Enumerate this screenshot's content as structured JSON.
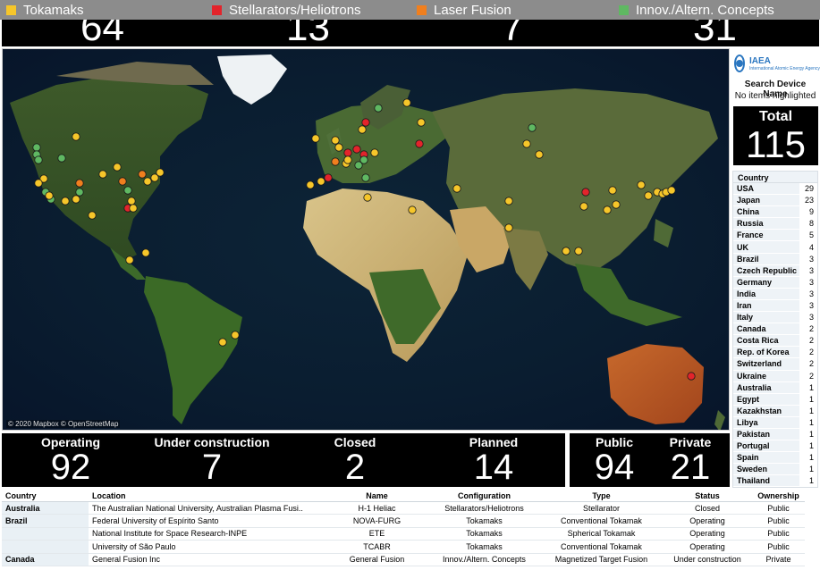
{
  "legend": [
    {
      "label": "Tokamaks",
      "color": "#f6c62a"
    },
    {
      "label": "Stellarators/Heliotrons",
      "color": "#e3242b"
    },
    {
      "label": "Laser Fusion",
      "color": "#f07f1e"
    },
    {
      "label": "Innov./Altern. Concepts",
      "color": "#5fb862"
    }
  ],
  "top_counts": [
    "64",
    "13",
    "7",
    "31"
  ],
  "map": {
    "attribution": "© 2020 Mapbox © OpenStreetMap"
  },
  "logo": {
    "title": "IAEA",
    "subtitle": "International Atomic Energy Agency"
  },
  "search": {
    "label": "Search Device Name",
    "status": "No items highlighted"
  },
  "total": {
    "label": "Total",
    "value": "115"
  },
  "country_list": {
    "header": "Country",
    "rows": [
      {
        "country": "USA",
        "count": "29"
      },
      {
        "country": "Japan",
        "count": "23"
      },
      {
        "country": "China",
        "count": "9"
      },
      {
        "country": "Russia",
        "count": "8"
      },
      {
        "country": "France",
        "count": "5"
      },
      {
        "country": "UK",
        "count": "4"
      },
      {
        "country": "Brazil",
        "count": "3"
      },
      {
        "country": "Czech Republic",
        "count": "3"
      },
      {
        "country": "Germany",
        "count": "3"
      },
      {
        "country": "India",
        "count": "3"
      },
      {
        "country": "Iran",
        "count": "3"
      },
      {
        "country": "Italy",
        "count": "3"
      },
      {
        "country": "Canada",
        "count": "2"
      },
      {
        "country": "Costa Rica",
        "count": "2"
      },
      {
        "country": "Rep. of Korea",
        "count": "2"
      },
      {
        "country": "Switzerland",
        "count": "2"
      },
      {
        "country": "Ukraine",
        "count": "2"
      },
      {
        "country": "Australia",
        "count": "1"
      },
      {
        "country": "Egypt",
        "count": "1"
      },
      {
        "country": "Kazakhstan",
        "count": "1"
      },
      {
        "country": "Libya",
        "count": "1"
      },
      {
        "country": "Pakistan",
        "count": "1"
      },
      {
        "country": "Portugal",
        "count": "1"
      },
      {
        "country": "Spain",
        "count": "1"
      },
      {
        "country": "Sweden",
        "count": "1"
      },
      {
        "country": "Thailand",
        "count": "1"
      }
    ]
  },
  "status": [
    {
      "label": "Operating",
      "value": "92"
    },
    {
      "label": "Under construction",
      "value": "7"
    },
    {
      "label": "Closed",
      "value": "2"
    },
    {
      "label": "Planned",
      "value": "14"
    }
  ],
  "ownership": [
    {
      "label": "Public",
      "value": "94"
    },
    {
      "label": "Private",
      "value": "21"
    }
  ],
  "table": {
    "headers": [
      "Country",
      "Location",
      "Name",
      "Configuration",
      "Type",
      "Status",
      "Ownership"
    ],
    "rows": [
      {
        "country": "Australia",
        "location": "The Australian National University, Australian Plasma Fusi..",
        "name": "H-1 Heliac",
        "configuration": "Stellarators/Heliotrons",
        "type": "Stellarator",
        "status": "Closed",
        "ownership": "Public"
      },
      {
        "country": "Brazil",
        "location": "Federal University of Espírito Santo",
        "name": "NOVA-FURG",
        "configuration": "Tokamaks",
        "type": "Conventional Tokamak",
        "status": "Operating",
        "ownership": "Public"
      },
      {
        "country": "",
        "location": "National Institute for Space Research-INPE",
        "name": "ETE",
        "configuration": "Tokamaks",
        "type": "Spherical Tokamak",
        "status": "Operating",
        "ownership": "Public"
      },
      {
        "country": "",
        "location": "University of São Paulo",
        "name": "TCABR",
        "configuration": "Tokamaks",
        "type": "Conventional Tokamak",
        "status": "Operating",
        "ownership": "Public"
      },
      {
        "country": "Canada",
        "location": "General Fusion Inc",
        "name": "General Fusion",
        "configuration": "Innov./Altern. Concepts",
        "type": "Magnetized Target Fusion",
        "status": "Under construction",
        "ownership": "Private"
      }
    ]
  }
}
